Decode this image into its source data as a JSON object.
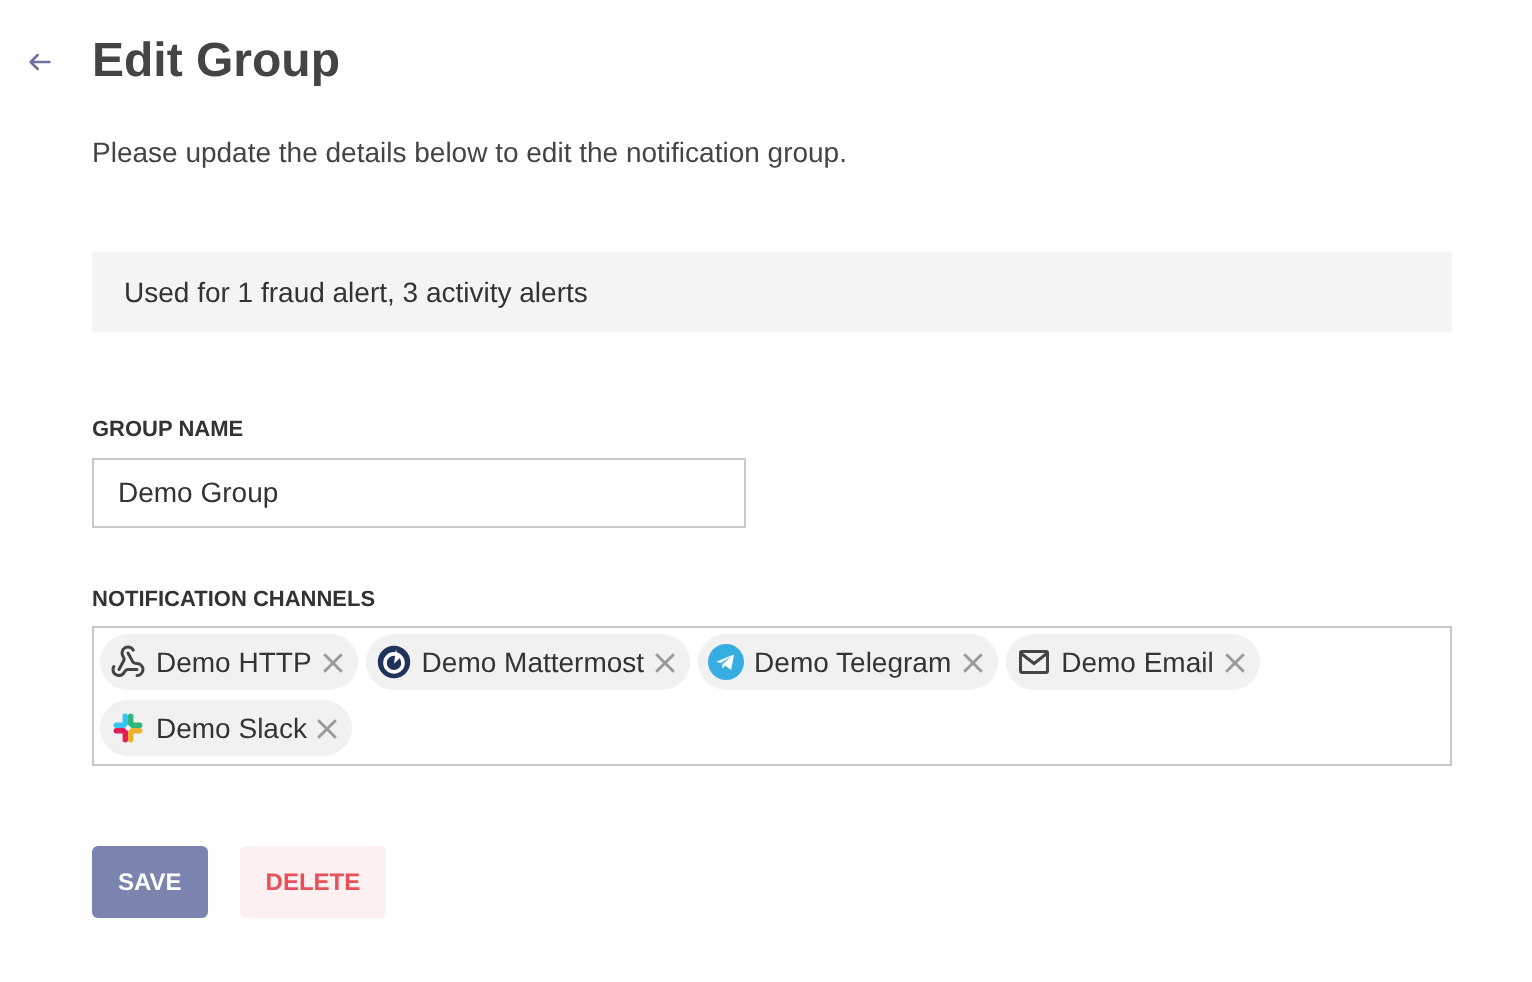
{
  "header": {
    "title": "Edit Group",
    "subtitle": "Please update the details below to edit the notification group."
  },
  "usage_note": "Used for 1 fraud alert, 3 activity alerts",
  "group_name": {
    "label": "GROUP NAME",
    "value": "Demo Group"
  },
  "channels": {
    "label": "NOTIFICATION CHANNELS",
    "items": [
      {
        "kind": "http",
        "name": "Demo HTTP"
      },
      {
        "kind": "mattermost",
        "name": "Demo Mattermost"
      },
      {
        "kind": "telegram",
        "name": "Demo Telegram"
      },
      {
        "kind": "email",
        "name": "Demo Email"
      },
      {
        "kind": "slack",
        "name": "Demo Slack"
      }
    ]
  },
  "buttons": [
    {
      "kind": "primary",
      "label": "SAVE"
    },
    {
      "kind": "danger",
      "label": "DELETE"
    }
  ]
}
